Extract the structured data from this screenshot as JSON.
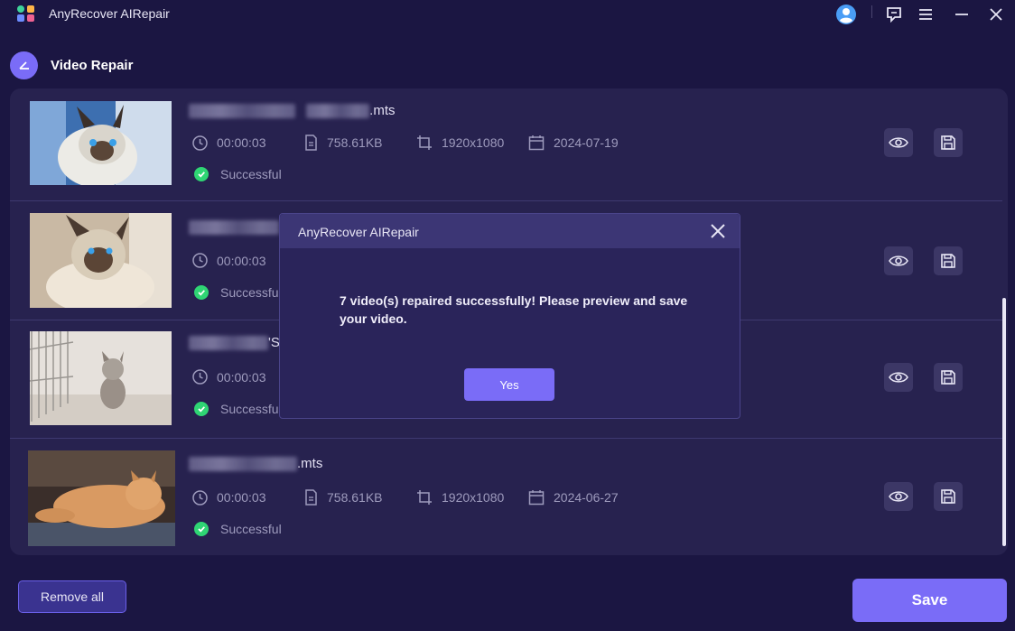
{
  "app": {
    "title": "AnyRecover AIRepair"
  },
  "header": {
    "title": "Video Repair"
  },
  "videos": [
    {
      "name_suffix": ".mts",
      "duration": "00:00:03",
      "size": "758.61KB",
      "resolution": "1920x1080",
      "date": "2024-07-19",
      "status": "Successful"
    },
    {
      "name_suffix": "",
      "duration": "00:00:03",
      "status": "Successful"
    },
    {
      "name_suffix": "'S",
      "duration": "00:00:03",
      "status": "Successful"
    },
    {
      "name_suffix": ".mts",
      "duration": "00:00:03",
      "size": "758.61KB",
      "resolution": "1920x1080",
      "date": "2024-06-27",
      "status": "Successful"
    }
  ],
  "footer": {
    "remove_all": "Remove all",
    "save": "Save"
  },
  "dialog": {
    "title": "AnyRecover AIRepair",
    "message": "7 video(s) repaired successfully! Please preview and save your video.",
    "yes": "Yes"
  },
  "colors": {
    "accent": "#7a6cf7",
    "success": "#2fd574",
    "background": "#1b1642",
    "panel": "#27224f"
  }
}
